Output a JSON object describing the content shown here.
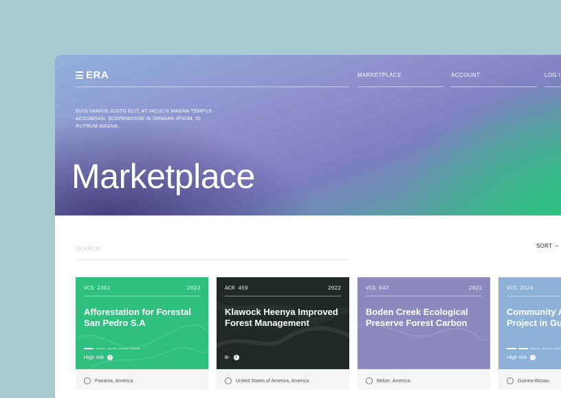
{
  "header": {
    "logo": "ERA",
    "nav": [
      "MARKETPLACE",
      "ACCOUNT",
      "LOG I"
    ],
    "tagline": "DUIS VARIUS JUSTO ELIT, AT IACULIS MAGNA TEMPUS ACCUMSAN. SUSPENDISSE IN ORNARE IPSUM, ID RUTRUM MAGNA.",
    "title": "Marketplace"
  },
  "search": {
    "placeholder": "SEARCH",
    "value": ""
  },
  "sort": {
    "label": "SORT"
  },
  "cards": [
    {
      "code": "VCS 2361",
      "year": "2023",
      "title": "Afforestation for Forestal San Pedro S.A",
      "risk_label": "High risk",
      "risk_level": 0.2,
      "bg": "#2fbf7f",
      "location": "Panama, America"
    },
    {
      "code": "ACR 459",
      "year": "2022",
      "title": "Klawock Heenya Improved Forest Management",
      "risk_label": "B-",
      "bg": "#1f2a25",
      "location": "United States of America, America"
    },
    {
      "code": "VCS 647",
      "year": "2021",
      "title": "Boden Creek Ecological Preserve Forest Carbon",
      "risk_label": "",
      "bg": "#8b89be",
      "location": "Belize, America"
    },
    {
      "code": "VCS 2324",
      "year": "",
      "title": "Community Avoided Def Project in Gu",
      "risk_label": "High risk",
      "risk_level": 0.4,
      "bg": "#8eb1d8",
      "location": "Guinea-Bissau"
    }
  ],
  "colors": {
    "background": "#a9cbd2",
    "accent_green": "#2bc27f",
    "accent_purple": "#8f8ccb"
  }
}
